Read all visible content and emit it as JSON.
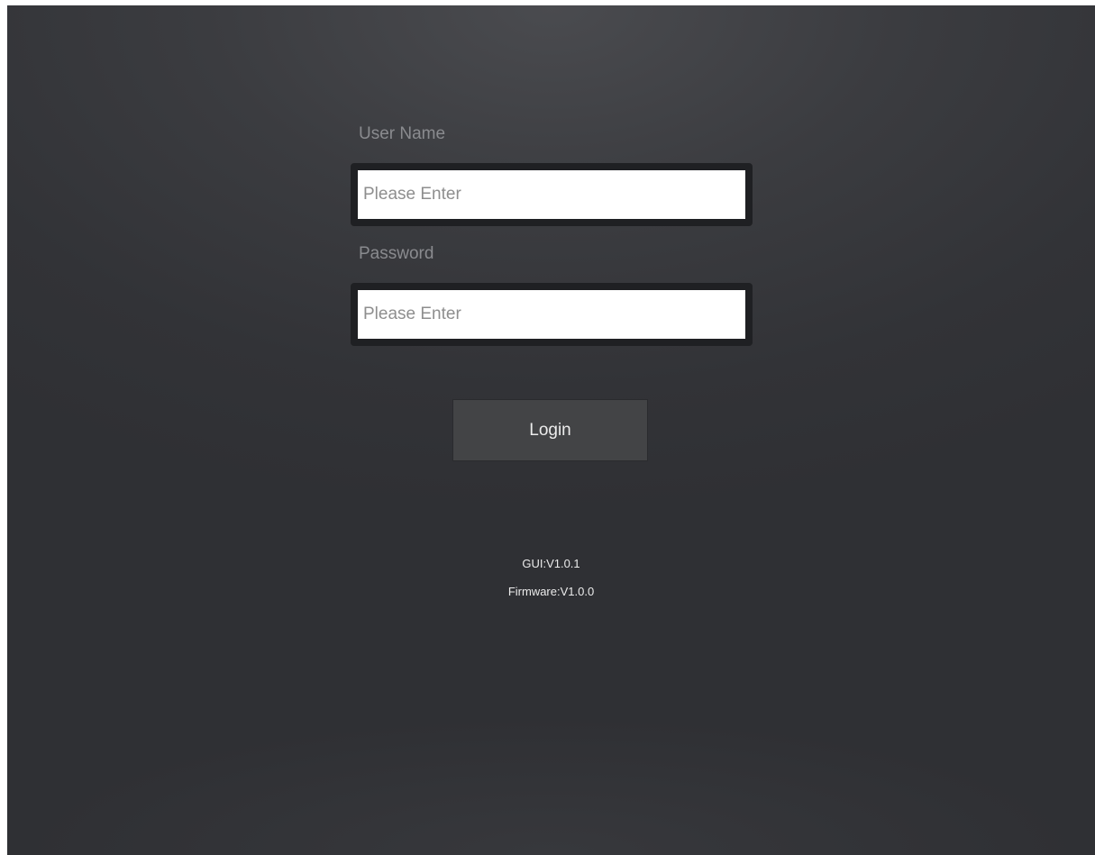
{
  "login_form": {
    "username": {
      "label": "User Name",
      "placeholder": "Please Enter",
      "value": ""
    },
    "password": {
      "label": "Password",
      "placeholder": "Please Enter",
      "value": ""
    },
    "login_label": "Login"
  },
  "footer": {
    "gui_version": "GUI:V1.0.1",
    "firmware_version": "Firmware:V1.0.0"
  },
  "colors": {
    "background": "#3b3c40",
    "input_frame": "#1f2023",
    "button": "#434446",
    "label_text": "#8a8b8f",
    "light_text": "#ececec"
  }
}
